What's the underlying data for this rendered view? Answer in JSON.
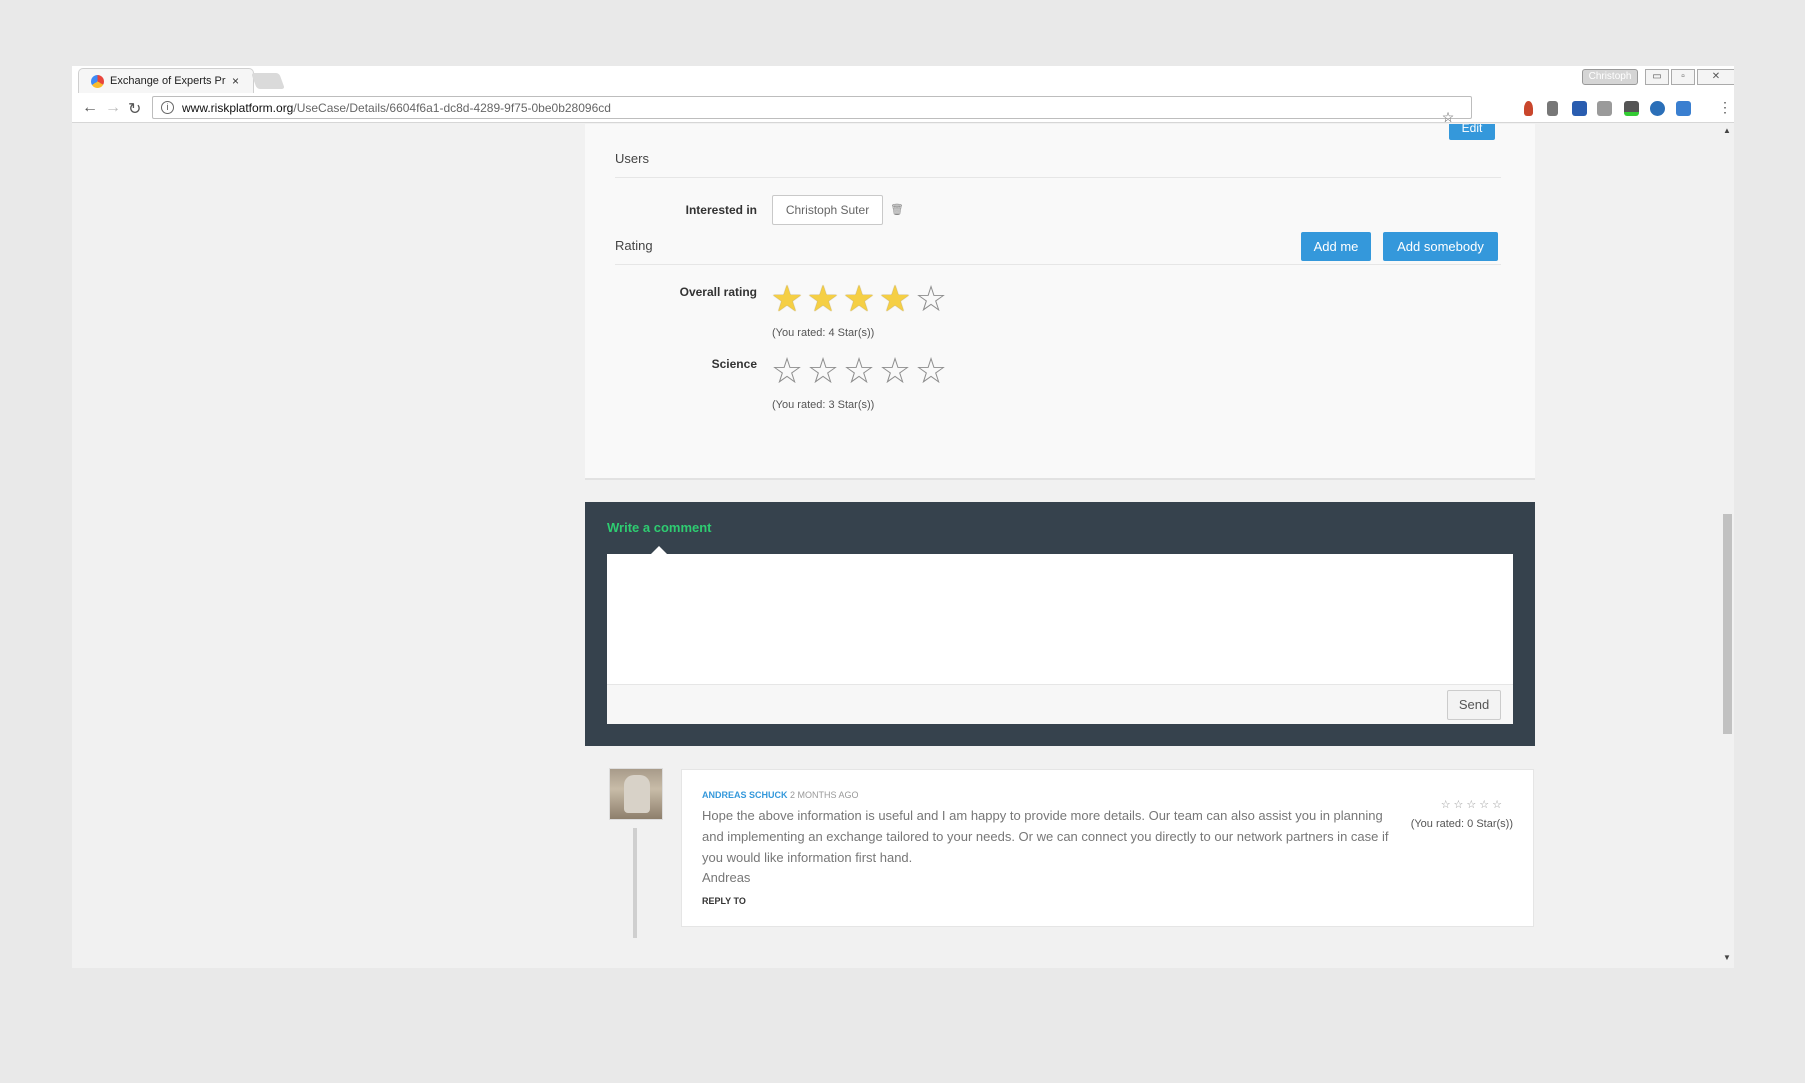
{
  "browser": {
    "tab_title": "Exchange of Experts Proj",
    "tab_close": "×",
    "profile_name": "Christoph",
    "window_buttons": [
      "▭",
      "▫",
      "✕"
    ],
    "url_host": "www.riskplatform.org",
    "url_path": "/UseCase/Details/6604f6a1-dc8d-4289-9f75-0be0b28096cd",
    "nav": {
      "back": "←",
      "forward": "→",
      "reload": "↻"
    },
    "bookmark_star": "☆",
    "menu": "⋮"
  },
  "panel": {
    "edit_label": "Edit",
    "users_title": "Users",
    "interested_label": "Interested in",
    "interested_person": "Christoph Suter",
    "trash_icon": "🗑",
    "rating_title": "Rating",
    "add_me_label": "Add me",
    "add_somebody_label": "Add somebody",
    "overall_label": "Overall rating",
    "overall_stars": 4,
    "overall_rated_text": "(You rated: 4 Star(s))",
    "science_label": "Science",
    "science_stars": 0,
    "science_rated_text": "(You rated: 3 Star(s))"
  },
  "comment_form": {
    "heading": "Write a comment",
    "send_label": "Send"
  },
  "comments": [
    {
      "author": "Andreas Schuck",
      "time": "2 months ago",
      "text": "Hope the above information is useful and I am happy to provide more details. Our team can also assist you in planning and implementing an exchange tailored to your needs. Or we can connect you directly to our network partners in case if you would like information first hand.",
      "signature": "Andreas",
      "reply_label": "REPLY TO",
      "stars": "☆☆☆☆☆",
      "rated_text": "(You rated: 0 Star(s))"
    }
  ],
  "colors": {
    "primary": "#3498db",
    "comment_bg": "#36424d",
    "comment_heading": "#2ecc71",
    "star_on": "#f5cf44"
  }
}
